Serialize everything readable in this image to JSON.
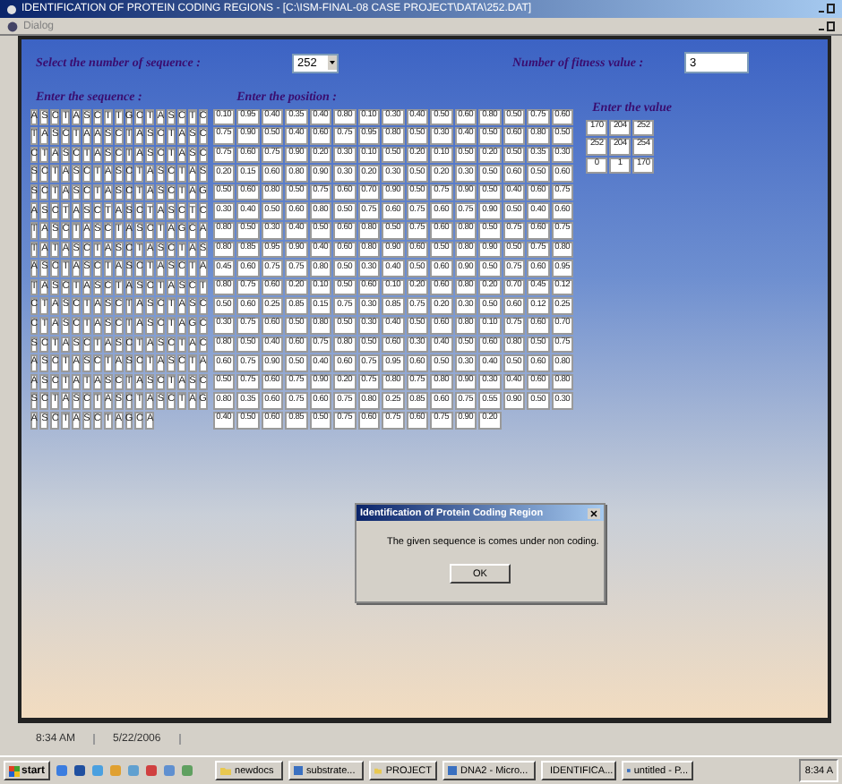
{
  "window": {
    "title": "IDENTIFICATION OF PROTEIN CODING REGIONS - [C:\\ISM-FINAL-08 CASE PROJECT\\DATA\\252.DAT]"
  },
  "child_window": {
    "title": "Dialog"
  },
  "form": {
    "sequence_count_label": "Select the number of sequence :",
    "sequence_count": "252",
    "fitness_label": "Number of fitness value :",
    "fitness_value": "3",
    "sequence_label": "Enter the sequence :",
    "position_label": "Enter the position :",
    "value_label": "Enter the value",
    "sequences": [
      [
        "A",
        "S",
        "C",
        "T",
        "A",
        "S",
        "C",
        "T",
        "T",
        "G",
        "C",
        "T",
        "A",
        "S",
        "C",
        "T",
        "C"
      ],
      [
        "T",
        "A",
        "S",
        "C",
        "T",
        "A",
        "A",
        "S",
        "C",
        "T",
        "A",
        "S",
        "C",
        "T",
        "A",
        "S",
        "C"
      ],
      [
        "C",
        "T",
        "A",
        "S",
        "C",
        "T",
        "A",
        "S",
        "C",
        "T",
        "A",
        "S",
        "C",
        "T",
        "A",
        "S",
        "C"
      ],
      [
        "S",
        "C",
        "T",
        "A",
        "S",
        "C",
        "T",
        "A",
        "S",
        "C",
        "T",
        "A",
        "S",
        "C",
        "T",
        "A",
        "S"
      ],
      [
        "S",
        "C",
        "T",
        "A",
        "S",
        "C",
        "T",
        "A",
        "S",
        "C",
        "T",
        "A",
        "S",
        "C",
        "T",
        "A",
        "G"
      ],
      [
        "A",
        "S",
        "C",
        "T",
        "A",
        "S",
        "C",
        "T",
        "A",
        "S",
        "C",
        "T",
        "A",
        "S",
        "C",
        "T",
        "C"
      ],
      [
        "T",
        "A",
        "S",
        "C",
        "T",
        "A",
        "S",
        "C",
        "T",
        "A",
        "S",
        "C",
        "T",
        "A",
        "G",
        "C",
        "A"
      ],
      [
        "T",
        "A",
        "T",
        "A",
        "S",
        "C",
        "T",
        "A",
        "S",
        "C",
        "T",
        "A",
        "S",
        "C",
        "T",
        "A",
        "S"
      ],
      [
        "A",
        "S",
        "C",
        "T",
        "A",
        "S",
        "C",
        "T",
        "A",
        "S",
        "C",
        "T",
        "A",
        "S",
        "C",
        "T",
        "A"
      ],
      [
        "T",
        "A",
        "S",
        "C",
        "T",
        "A",
        "S",
        "C",
        "T",
        "A",
        "S",
        "C",
        "T",
        "A",
        "S",
        "C",
        "T"
      ],
      [
        "C",
        "T",
        "A",
        "S",
        "C",
        "T",
        "A",
        "S",
        "C",
        "T",
        "A",
        "S",
        "C",
        "T",
        "A",
        "S",
        "C"
      ],
      [
        "C",
        "T",
        "A",
        "S",
        "C",
        "T",
        "A",
        "S",
        "C",
        "T",
        "A",
        "S",
        "C",
        "T",
        "A",
        "G",
        "C"
      ],
      [
        "S",
        "C",
        "T",
        "A",
        "S",
        "C",
        "T",
        "A",
        "S",
        "C",
        "T",
        "A",
        "S",
        "C",
        "T",
        "A",
        "C"
      ],
      [
        "A",
        "S",
        "C",
        "T",
        "A",
        "S",
        "C",
        "T",
        "A",
        "S",
        "C",
        "T",
        "A",
        "S",
        "C",
        "T",
        "A"
      ],
      [
        "A",
        "S",
        "C",
        "T",
        "A",
        "T",
        "A",
        "S",
        "C",
        "T",
        "A",
        "S",
        "C",
        "T",
        "A",
        "S",
        "C"
      ],
      [
        "S",
        "C",
        "T",
        "A",
        "S",
        "C",
        "T",
        "A",
        "S",
        "C",
        "T",
        "A",
        "S",
        "C",
        "T",
        "A",
        "G"
      ],
      [
        "A",
        "S",
        "C",
        "T",
        "A",
        "S",
        "C",
        "T",
        "A",
        "G",
        "C",
        "A"
      ]
    ],
    "positions": [
      [
        "0.10",
        "0.95",
        "0.40",
        "0.35",
        "0.40",
        "0.80",
        "0.10",
        "0.30",
        "0.40",
        "0.50",
        "0.60",
        "0.80",
        "0.50",
        "0.75",
        "0.60"
      ],
      [
        "0.75",
        "0.90",
        "0.50",
        "0.40",
        "0.60",
        "0.75",
        "0.95",
        "0.80",
        "0.50",
        "0.30",
        "0.40",
        "0.50",
        "0.60",
        "0.80",
        "0.50"
      ],
      [
        "0.75",
        "0.60",
        "0.75",
        "0.90",
        "0.20",
        "0.30",
        "0.10",
        "0.50",
        "0.20",
        "0.10",
        "0.50",
        "0.20",
        "0.50",
        "0.35",
        "0.30"
      ],
      [
        "0.20",
        "0.15",
        "0.60",
        "0.80",
        "0.90",
        "0.30",
        "0.20",
        "0.30",
        "0.50",
        "0.20",
        "0.30",
        "0.50",
        "0.60",
        "0.50",
        "0.60"
      ],
      [
        "0.50",
        "0.60",
        "0.80",
        "0.50",
        "0.75",
        "0.60",
        "0.70",
        "0.90",
        "0.50",
        "0.75",
        "0.90",
        "0.50",
        "0.40",
        "0.60",
        "0.75"
      ],
      [
        "0.30",
        "0.40",
        "0.50",
        "0.60",
        "0.80",
        "0.50",
        "0.75",
        "0.60",
        "0.75",
        "0.60",
        "0.75",
        "0.90",
        "0.50",
        "0.40",
        "0.60"
      ],
      [
        "0.80",
        "0.50",
        "0.30",
        "0.40",
        "0.50",
        "0.60",
        "0.80",
        "0.50",
        "0.75",
        "0.60",
        "0.80",
        "0.50",
        "0.75",
        "0.60",
        "0.75"
      ],
      [
        "0.80",
        "0.85",
        "0.95",
        "0.90",
        "0.40",
        "0.60",
        "0.80",
        "0.90",
        "0.60",
        "0.50",
        "0.80",
        "0.90",
        "0.50",
        "0.75",
        "0.80"
      ],
      [
        "0.45",
        "0.60",
        "0.75",
        "0.75",
        "0.80",
        "0.50",
        "0.30",
        "0.40",
        "0.50",
        "0.60",
        "0.90",
        "0.50",
        "0.75",
        "0.60",
        "0.95"
      ],
      [
        "0.80",
        "0.75",
        "0.60",
        "0.20",
        "0.10",
        "0.50",
        "0.60",
        "0.10",
        "0.20",
        "0.60",
        "0.80",
        "0.20",
        "0.70",
        "0.45",
        "0.12"
      ],
      [
        "0.50",
        "0.60",
        "0.25",
        "0.85",
        "0.15",
        "0.75",
        "0.30",
        "0.85",
        "0.75",
        "0.20",
        "0.30",
        "0.50",
        "0.60",
        "0.12",
        "0.25"
      ],
      [
        "0.30",
        "0.75",
        "0.60",
        "0.50",
        "0.80",
        "0.50",
        "0.30",
        "0.40",
        "0.50",
        "0.60",
        "0.80",
        "0.10",
        "0.75",
        "0.60",
        "0.70"
      ],
      [
        "0.80",
        "0.50",
        "0.40",
        "0.60",
        "0.75",
        "0.80",
        "0.50",
        "0.60",
        "0.30",
        "0.40",
        "0.50",
        "0.60",
        "0.80",
        "0.50",
        "0.75"
      ],
      [
        "0.60",
        "0.75",
        "0.90",
        "0.50",
        "0.40",
        "0.60",
        "0.75",
        "0.95",
        "0.60",
        "0.50",
        "0.30",
        "0.40",
        "0.50",
        "0.60",
        "0.80"
      ],
      [
        "0.50",
        "0.75",
        "0.60",
        "0.75",
        "0.90",
        "0.20",
        "0.75",
        "0.80",
        "0.75",
        "0.80",
        "0.90",
        "0.30",
        "0.40",
        "0.60",
        "0.80"
      ],
      [
        "0.80",
        "0.35",
        "0.60",
        "0.75",
        "0.60",
        "0.75",
        "0.80",
        "0.25",
        "0.85",
        "0.60",
        "0.75",
        "0.55",
        "0.90",
        "0.50",
        "0.30"
      ],
      [
        "0.40",
        "0.50",
        "0.60",
        "0.85",
        "0.50",
        "0.75",
        "0.60",
        "0.75",
        "0.60",
        "0.75",
        "0.90",
        "0.20"
      ]
    ],
    "values": [
      [
        "170",
        "204",
        "252"
      ],
      [
        "252",
        "204",
        "254"
      ],
      [
        "0",
        "1",
        "170"
      ]
    ]
  },
  "dialog": {
    "title": "Identification of Protein Coding Region",
    "message": "The given sequence is comes under non coding.",
    "button": "OK"
  },
  "status_bar": [
    "8:34 AM",
    "5/22/2006"
  ],
  "taskbar": {
    "start": "start",
    "tasks": [
      {
        "label": "newdocs",
        "kind": "folder"
      },
      {
        "label": "substrate...",
        "kind": "app"
      },
      {
        "label": "PROJECT",
        "kind": "folder"
      },
      {
        "label": "DNA2 - Micro...",
        "kind": "app"
      },
      {
        "label": "IDENTIFICA...",
        "kind": "app"
      },
      {
        "label": "untitled - P...",
        "kind": "app"
      }
    ],
    "clock": "8:34 A"
  }
}
